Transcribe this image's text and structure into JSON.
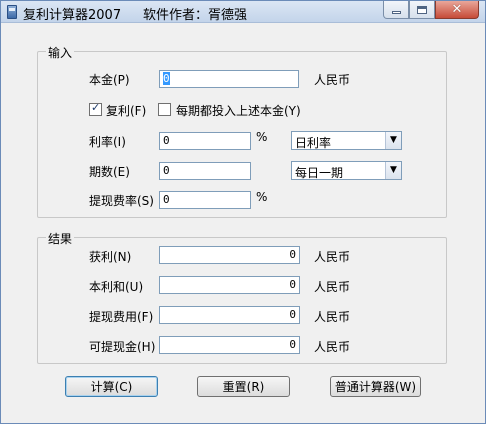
{
  "window": {
    "title": "复利计算器2007",
    "author": "软件作者：胥德强"
  },
  "input_group": {
    "title": "输入",
    "principal_label": "本金(P)",
    "principal_value": "0",
    "principal_unit": "人民币",
    "compound_label": "复利(F)",
    "compound_checked": true,
    "reinvest_label": "每期都投入上述本金(Y)",
    "reinvest_checked": false,
    "rate_label": "利率(I)",
    "rate_value": "0",
    "rate_unit": "%",
    "rate_type_value": "日利率",
    "periods_label": "期数(E)",
    "periods_value": "0",
    "period_type_value": "每日一期",
    "fee_rate_label": "提现费率(S)",
    "fee_rate_value": "0",
    "fee_rate_unit": "%"
  },
  "result_group": {
    "title": "结果",
    "profit_label": "获利(N)",
    "profit_value": "0",
    "profit_unit": "人民币",
    "total_label": "本利和(U)",
    "total_value": "0",
    "total_unit": "人民币",
    "fee_label": "提现费用(F)",
    "fee_value": "0",
    "fee_unit": "人民币",
    "withdrawable_label": "可提现金(H)",
    "withdrawable_value": "0",
    "withdrawable_unit": "人民币"
  },
  "buttons": {
    "calculate": "计算(C)",
    "reset": "重置(R)",
    "normal_calculator": "普通计算器(W)"
  }
}
